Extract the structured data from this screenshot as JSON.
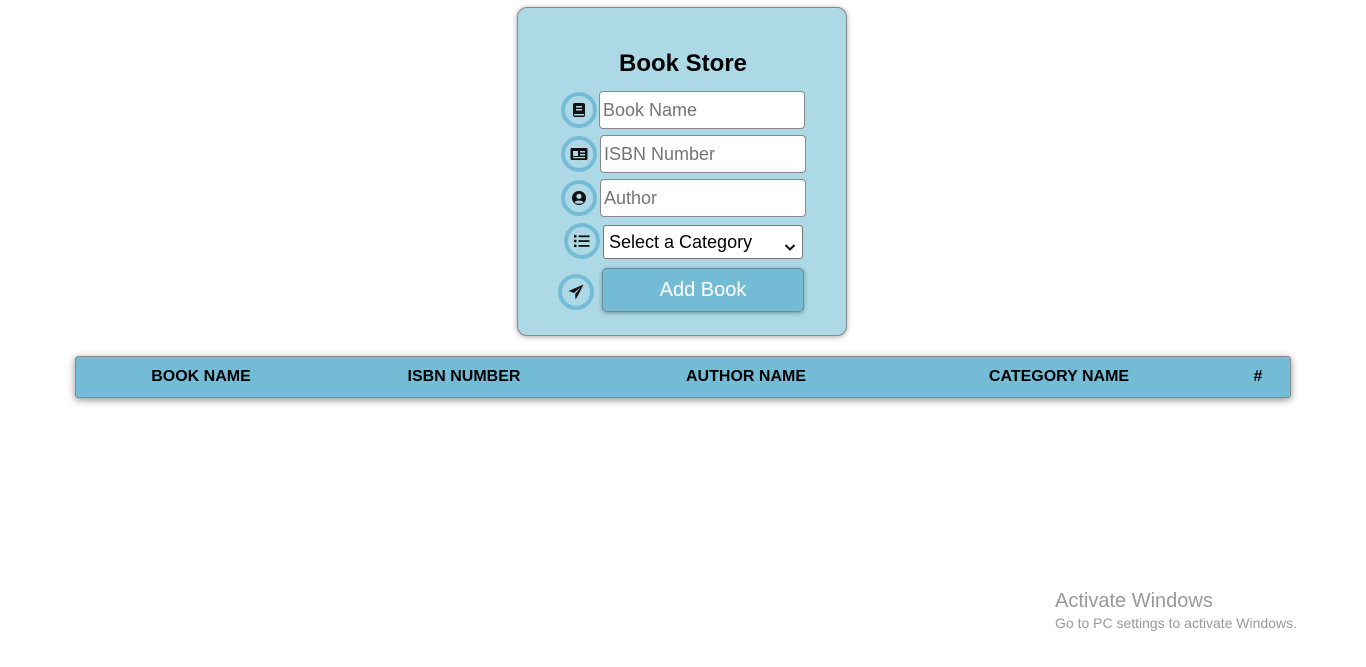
{
  "form": {
    "title": "Book Store",
    "book_name_placeholder": "Book Name",
    "isbn_placeholder": "ISBN Number",
    "author_placeholder": "Author",
    "category_selected": "Select a Category",
    "submit_label": "Add Book",
    "icons": [
      "book-icon",
      "id-card-icon",
      "user-circle-icon",
      "list-icon",
      "paper-plane-icon"
    ]
  },
  "table": {
    "headers": [
      "BOOK NAME",
      "ISBN NUMBER",
      "AUTHOR NAME",
      "CATEGORY NAME",
      "#"
    ]
  },
  "watermark": {
    "title": "Activate Windows",
    "subtitle": "Go to PC settings to activate Windows."
  },
  "colors": {
    "card_background": "#add8e6",
    "accent": "#74bcd6"
  }
}
